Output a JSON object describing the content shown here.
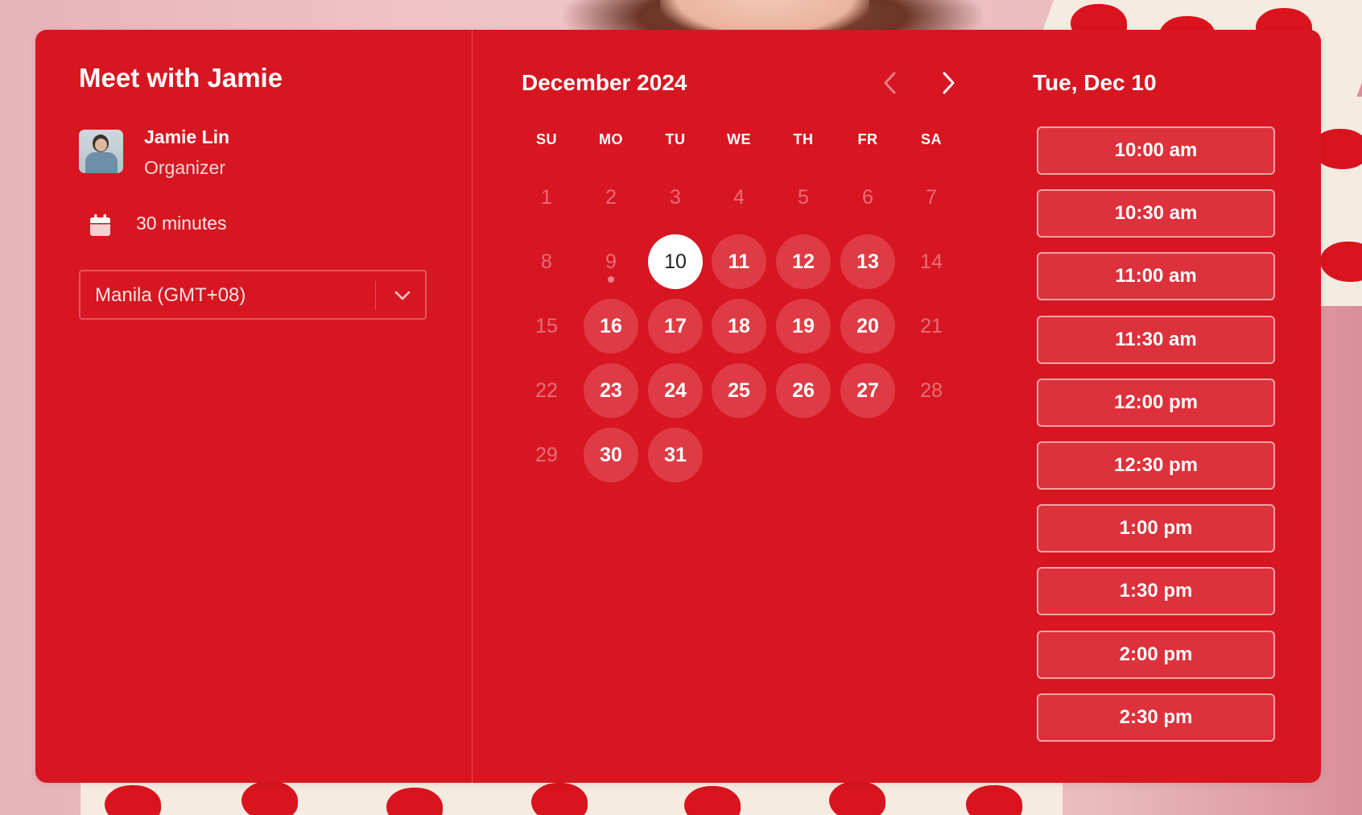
{
  "event": {
    "title": "Meet with Jamie",
    "organizer_name": "Jamie Lin",
    "organizer_role": "Organizer",
    "duration": "30 minutes",
    "duration_icon": "calendar-icon",
    "timezone": "Manila (GMT+08)"
  },
  "calendar": {
    "month_label": "December 2024",
    "weekdays": [
      "SU",
      "MO",
      "TU",
      "WE",
      "TH",
      "FR",
      "SA"
    ],
    "weeks": [
      [
        {
          "d": "1",
          "s": "disabled"
        },
        {
          "d": "2",
          "s": "disabled"
        },
        {
          "d": "3",
          "s": "disabled"
        },
        {
          "d": "4",
          "s": "disabled"
        },
        {
          "d": "5",
          "s": "disabled"
        },
        {
          "d": "6",
          "s": "disabled"
        },
        {
          "d": "7",
          "s": "disabled"
        }
      ],
      [
        {
          "d": "8",
          "s": "disabled"
        },
        {
          "d": "9",
          "s": "today"
        },
        {
          "d": "10",
          "s": "selected"
        },
        {
          "d": "11",
          "s": "available"
        },
        {
          "d": "12",
          "s": "available"
        },
        {
          "d": "13",
          "s": "available"
        },
        {
          "d": "14",
          "s": "disabled"
        }
      ],
      [
        {
          "d": "15",
          "s": "disabled"
        },
        {
          "d": "16",
          "s": "available"
        },
        {
          "d": "17",
          "s": "available"
        },
        {
          "d": "18",
          "s": "available"
        },
        {
          "d": "19",
          "s": "available"
        },
        {
          "d": "20",
          "s": "available"
        },
        {
          "d": "21",
          "s": "disabled"
        }
      ],
      [
        {
          "d": "22",
          "s": "disabled"
        },
        {
          "d": "23",
          "s": "available"
        },
        {
          "d": "24",
          "s": "available"
        },
        {
          "d": "25",
          "s": "available"
        },
        {
          "d": "26",
          "s": "available"
        },
        {
          "d": "27",
          "s": "available"
        },
        {
          "d": "28",
          "s": "disabled"
        }
      ],
      [
        {
          "d": "29",
          "s": "disabled"
        },
        {
          "d": "30",
          "s": "available"
        },
        {
          "d": "31",
          "s": "available"
        }
      ]
    ]
  },
  "slots": {
    "date_label": "Tue, Dec 10",
    "times": [
      "10:00 am",
      "10:30 am",
      "11:00 am",
      "11:30 am",
      "12:00 pm",
      "12:30 pm",
      "1:00 pm",
      "1:30 pm",
      "2:00 pm",
      "2:30 pm"
    ]
  },
  "colors": {
    "card": "#d71621",
    "available_day": "#df3b44",
    "selected_day": "#ffffff"
  }
}
